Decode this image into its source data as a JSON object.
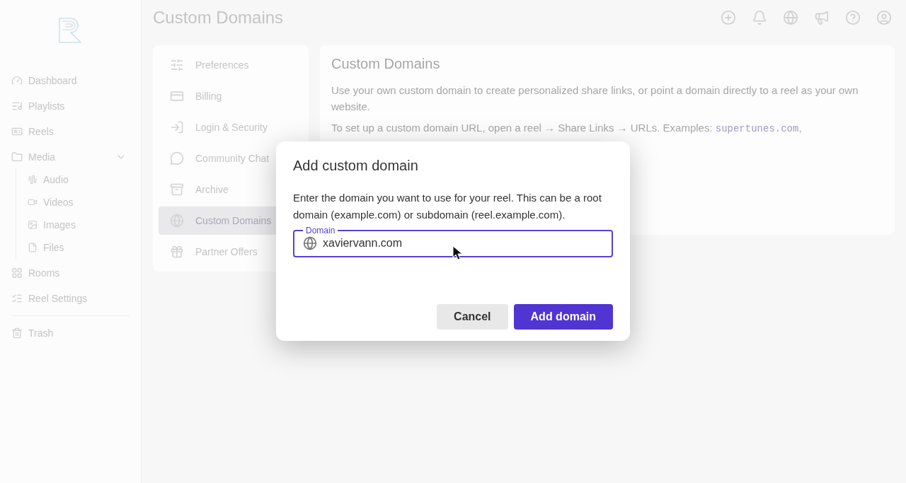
{
  "page_title": "Custom Domains",
  "sidebar": {
    "items": [
      {
        "label": "Dashboard"
      },
      {
        "label": "Playlists"
      },
      {
        "label": "Reels"
      },
      {
        "label": "Media",
        "expanded": true,
        "children": [
          {
            "label": "Audio"
          },
          {
            "label": "Videos"
          },
          {
            "label": "Images"
          },
          {
            "label": "Files"
          }
        ]
      },
      {
        "label": "Rooms"
      },
      {
        "label": "Reel Settings"
      }
    ],
    "bottom_items": [
      {
        "label": "Trash"
      }
    ]
  },
  "settings_nav": [
    {
      "label": "Preferences",
      "selected": false
    },
    {
      "label": "Billing",
      "selected": false
    },
    {
      "label": "Login & Security",
      "selected": false
    },
    {
      "label": "Community Chat",
      "selected": false
    },
    {
      "label": "Archive",
      "selected": false
    },
    {
      "label": "Custom Domains",
      "selected": true
    },
    {
      "label": "Partner Offers",
      "selected": false
    }
  ],
  "card": {
    "title": "Custom Domains",
    "paragraph": "Use your own custom domain to create personalized share links, or point a domain directly to a reel as your own website.",
    "setup_text": "To set up a custom domain URL, open a reel → Share Links → URLs. Examples:",
    "example": "supertunes.com",
    "example_suffix": ","
  },
  "dialog": {
    "title": "Add custom domain",
    "description": "Enter the domain you want to use for your reel. This can be a root domain (example.com) or subdomain (reel.example.com).",
    "field": {
      "label": "Domain",
      "value": "xaviervann.com",
      "focused": true
    },
    "buttons": [
      {
        "label": "Cancel",
        "kind": "secondary"
      },
      {
        "label": "Add domain",
        "kind": "primary"
      }
    ]
  }
}
